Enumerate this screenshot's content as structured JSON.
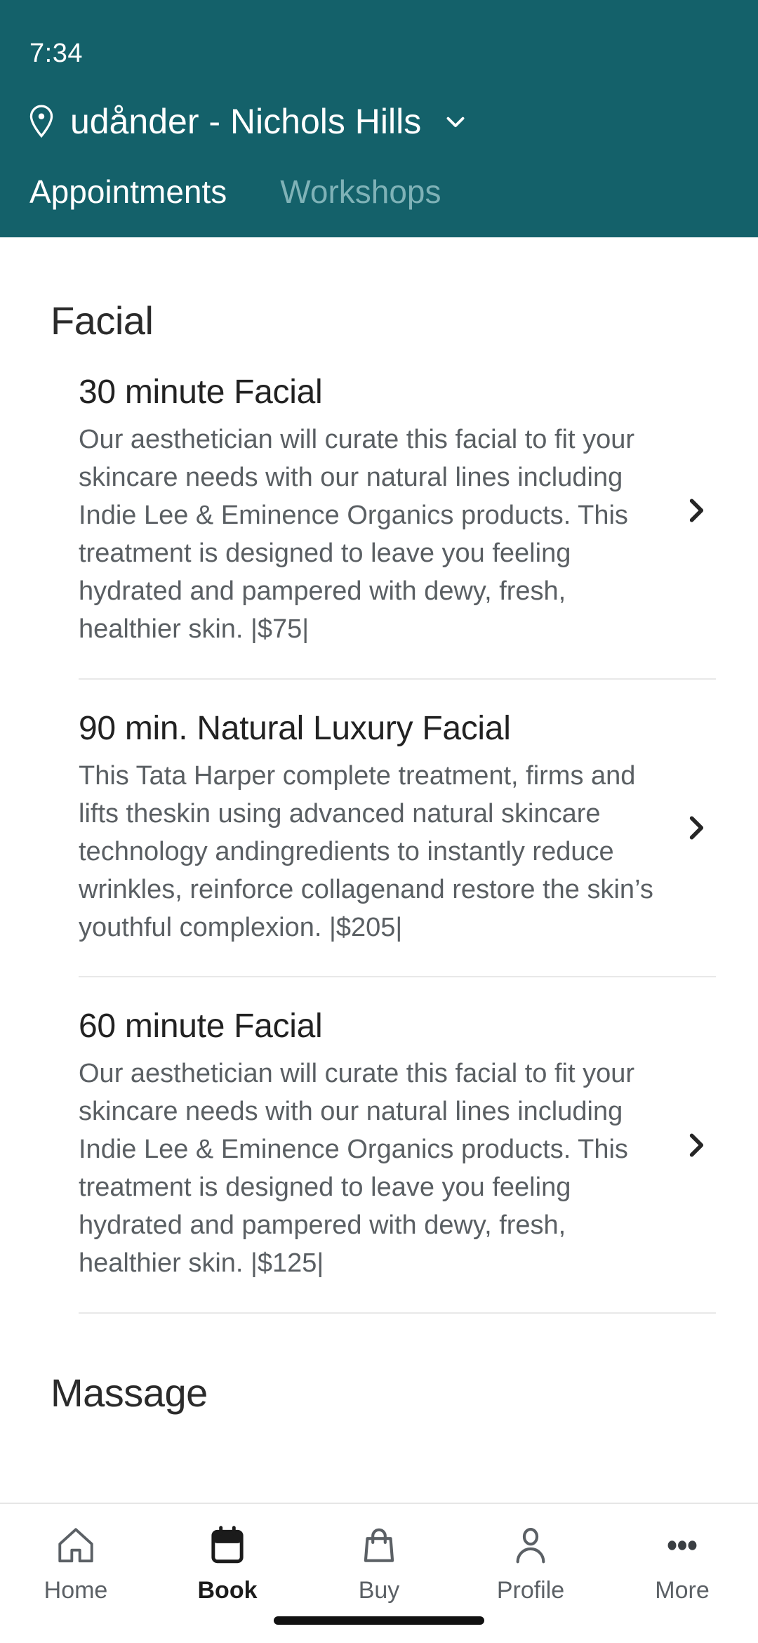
{
  "status_bar": {
    "time": "7:34"
  },
  "header": {
    "background_color": "#14616a",
    "location_icon": "location-pin-icon",
    "location_name": "udånder - Nichols Hills",
    "dropdown_icon": "chevron-down-icon",
    "tabs": [
      {
        "label": "Appointments",
        "active": true
      },
      {
        "label": "Workshops",
        "active": false
      }
    ]
  },
  "main": {
    "sections": [
      {
        "title": "Facial",
        "items": [
          {
            "title": "30 minute Facial",
            "description": "Our aesthetician will curate this facial to fit your skincare needs with our natural lines including Indie Lee & Eminence Organics products. This treatment is designed to leave you feeling hydrated and pampered with dewy, fresh, healthier skin. |$75|",
            "price": "|$75|",
            "chevron_icon": "chevron-right-icon"
          },
          {
            "title": "90 min. Natural Luxury Facial",
            "description": "This Tata Harper complete treatment, firms and lifts theskin using advanced natural skincare technology andingredients to instantly reduce wrinkles, reinforce collagenand restore the skin’s youthful complexion.   |$205|",
            "price": "|$205|",
            "chevron_icon": "chevron-right-icon"
          },
          {
            "title": "60 minute Facial",
            "description": "Our aesthetician will curate this facial to fit your skincare needs with our natural lines including Indie Lee & Eminence Organics products. This treatment is designed to leave you feeling hydrated and pampered with dewy, fresh, healthier skin. |$125|",
            "price": "|$125|",
            "chevron_icon": "chevron-right-icon"
          }
        ]
      },
      {
        "title": "Massage",
        "items": []
      }
    ]
  },
  "bottom_nav": {
    "items": [
      {
        "label": "Home",
        "icon": "home-icon",
        "active": false
      },
      {
        "label": "Book",
        "icon": "calendar-icon",
        "active": true
      },
      {
        "label": "Buy",
        "icon": "shopping-bag-icon",
        "active": false
      },
      {
        "label": "Profile",
        "icon": "person-icon",
        "active": false
      },
      {
        "label": "More",
        "icon": "more-dots-icon",
        "active": false
      }
    ]
  },
  "colors": {
    "header_teal": "#14616a",
    "tab_inactive": "#7fb2b7",
    "body_text": "#5a5f63",
    "title_text": "#222222"
  }
}
